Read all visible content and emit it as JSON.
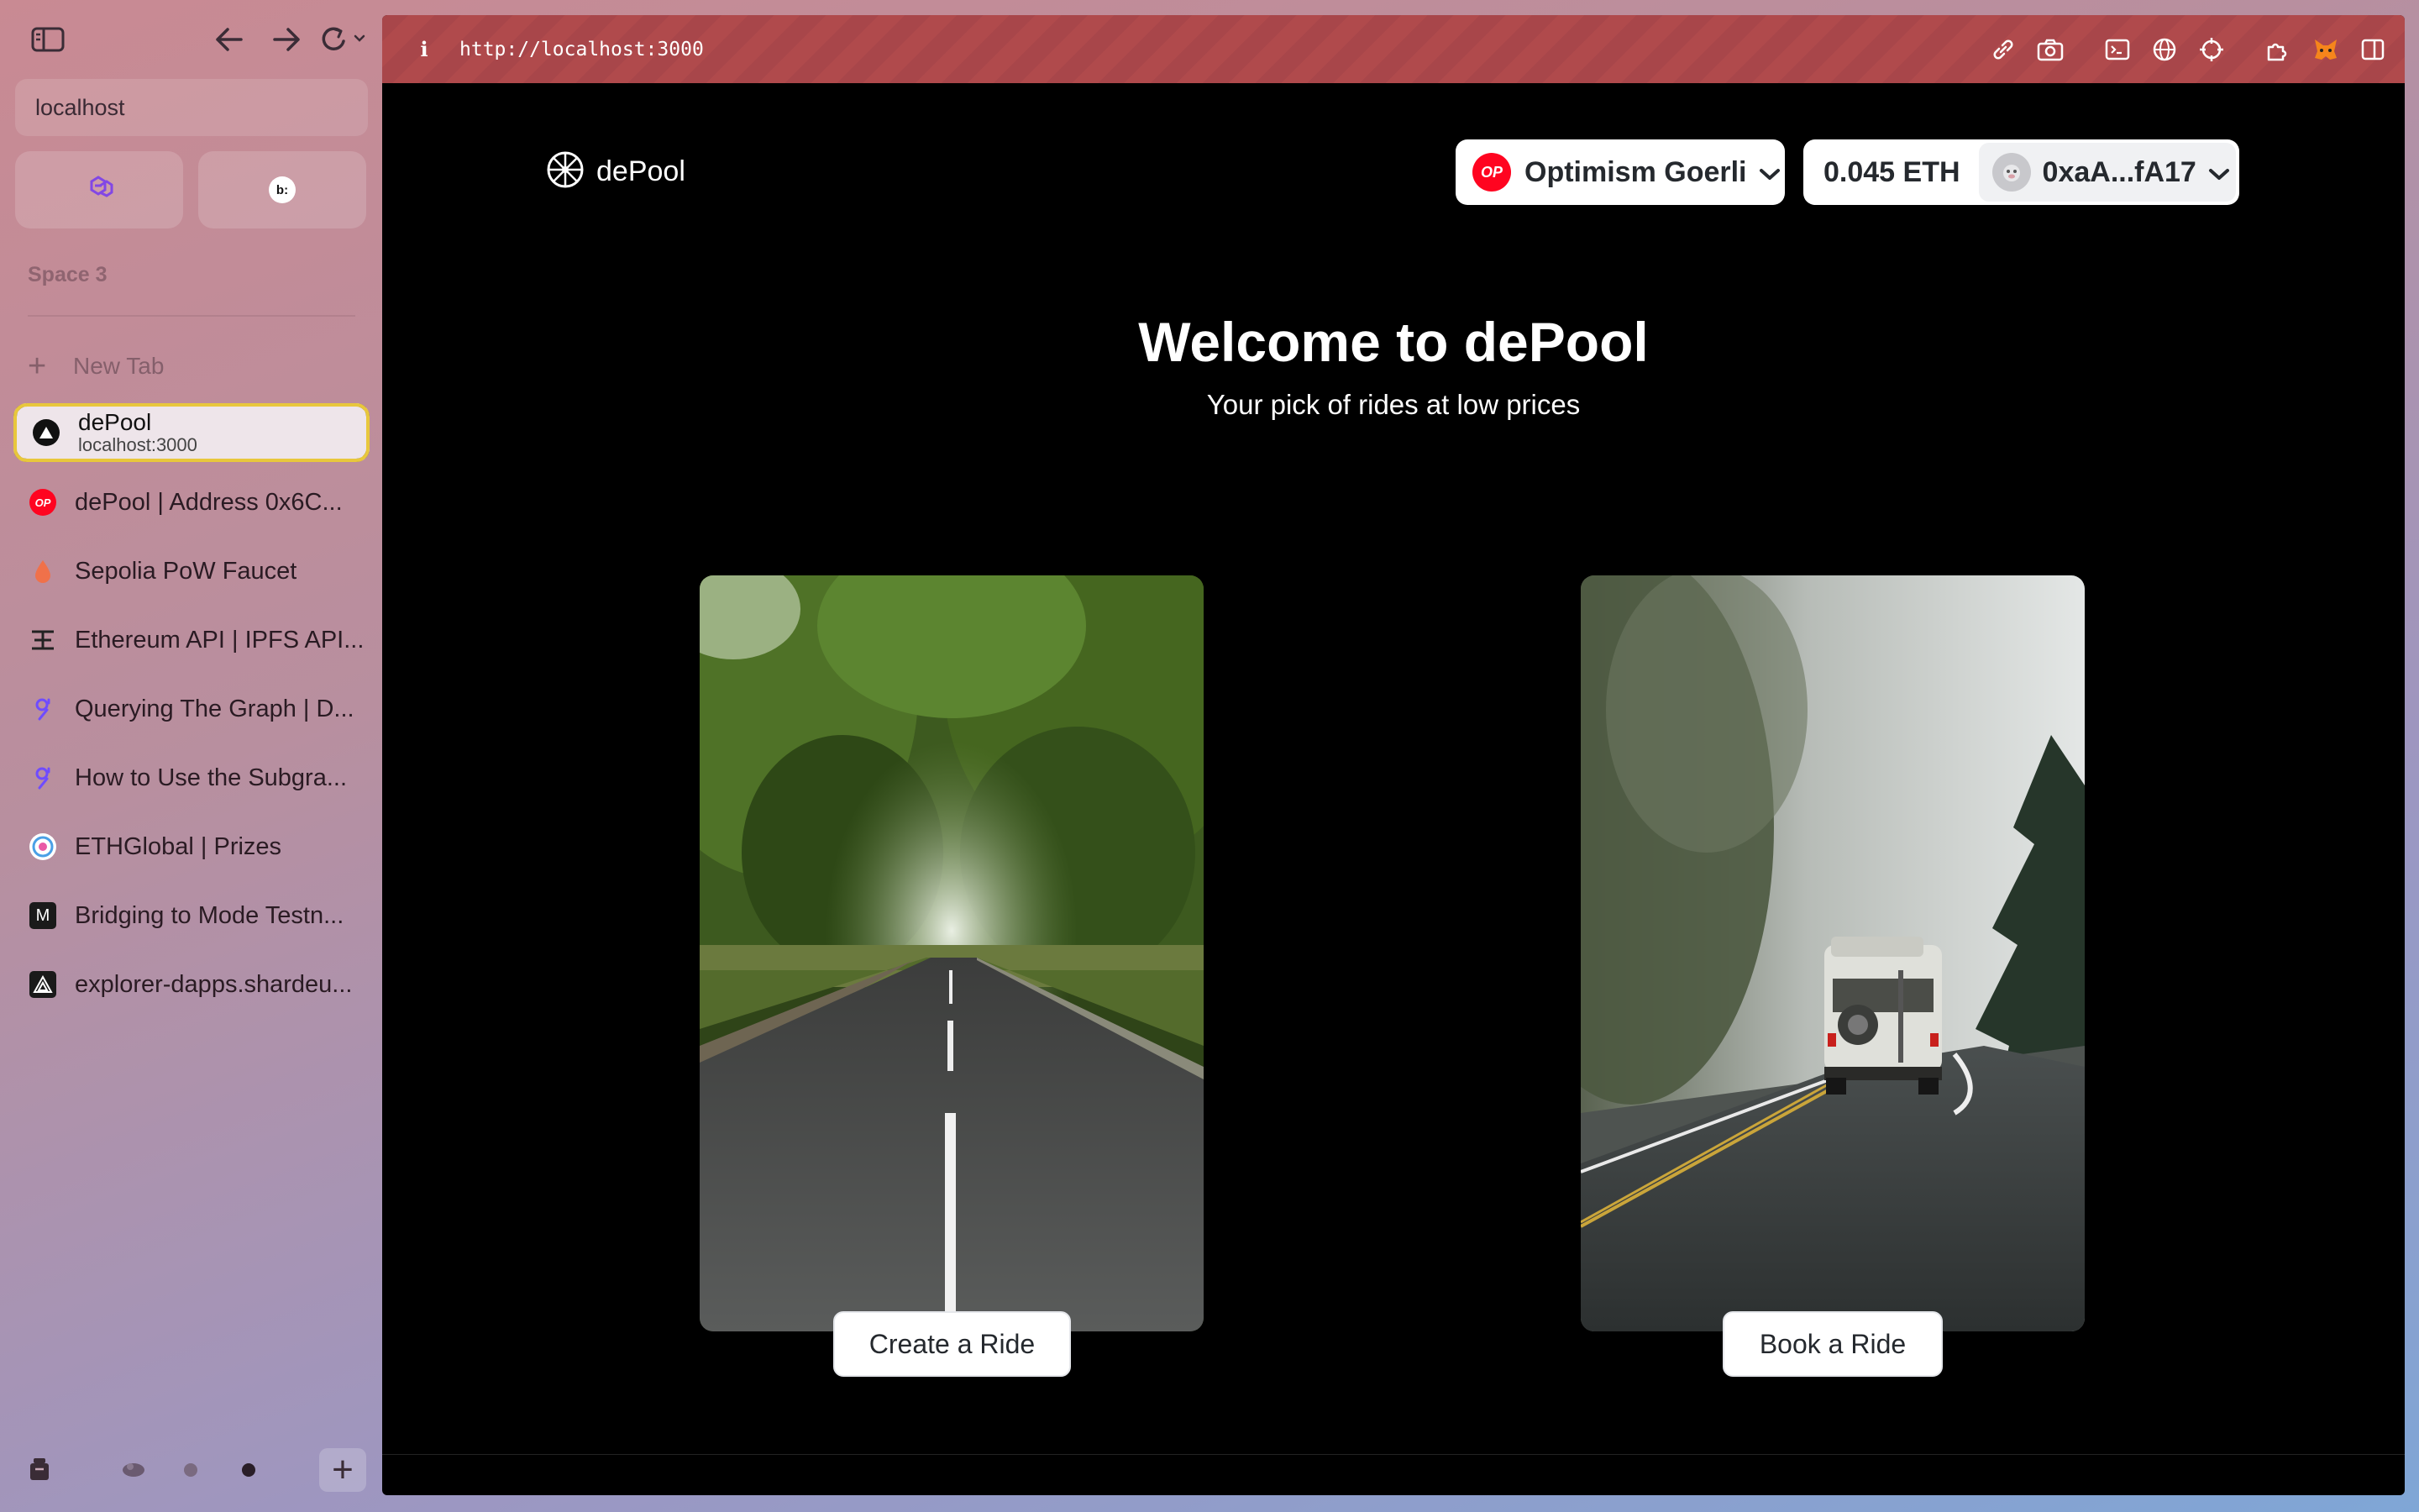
{
  "sidebar": {
    "url_text": "localhost",
    "space_label": "Space 3",
    "new_tab_label": "New Tab",
    "active_tab": {
      "title": "dePool",
      "subtitle": "localhost:3000"
    },
    "tabs": [
      {
        "label": "dePool | Address 0x6C...",
        "icon": "optimism-icon"
      },
      {
        "label": "Sepolia PoW Faucet",
        "icon": "drop-icon"
      },
      {
        "label": "Ethereum API | IPFS API...",
        "icon": "infura-icon"
      },
      {
        "label": "Querying The Graph | D...",
        "icon": "thegraph-icon"
      },
      {
        "label": "How to Use the Subgra...",
        "icon": "thegraph-icon"
      },
      {
        "label": "ETHGlobal | Prizes",
        "icon": "ethglobal-icon"
      },
      {
        "label": "Bridging to Mode Testn...",
        "icon": "mode-icon"
      },
      {
        "label": "explorer-dapps.shardeu...",
        "icon": "shardeum-icon"
      }
    ]
  },
  "browser": {
    "info_glyph": "i",
    "url": "http://localhost:3000"
  },
  "app": {
    "logo_text": "dePool",
    "network": {
      "badge": "OP",
      "label": "Optimism Goerli"
    },
    "account": {
      "balance": "0.045 ETH",
      "address": "0xaA...fA17"
    },
    "title": "Welcome to dePool",
    "subtitle": "Your pick of rides at low prices",
    "cards": {
      "create_label": "Create a Ride",
      "book_label": "Book a Ride"
    }
  },
  "colors": {
    "optimism_red": "#ff0420",
    "addressbar_red": "#a8464a",
    "page_background": "#000000"
  }
}
